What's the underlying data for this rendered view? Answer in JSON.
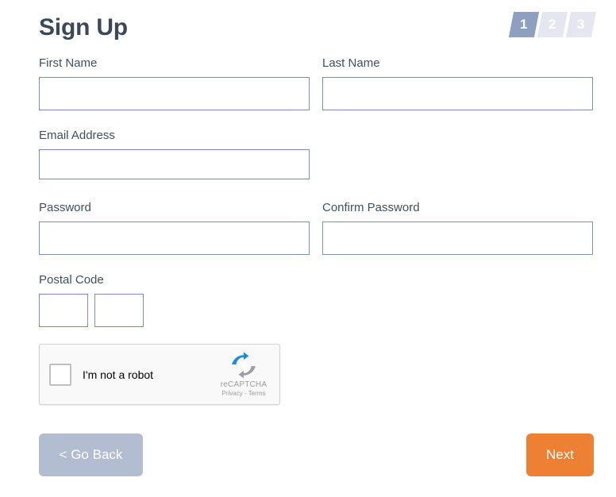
{
  "header": {
    "title": "Sign Up",
    "steps": [
      {
        "label": "1",
        "active": true
      },
      {
        "label": "2",
        "active": false
      },
      {
        "label": "3",
        "active": false
      }
    ]
  },
  "form": {
    "first_name": {
      "label": "First Name",
      "value": "",
      "placeholder": ""
    },
    "last_name": {
      "label": "Last Name",
      "value": "",
      "placeholder": ""
    },
    "email": {
      "label": "Email Address",
      "value": "",
      "placeholder": ""
    },
    "password": {
      "label": "Password",
      "value": "",
      "placeholder": ""
    },
    "confirm_password": {
      "label": "Confirm Password",
      "value": "",
      "placeholder": ""
    },
    "postal_code": {
      "label": "Postal Code",
      "part1_value": "",
      "part1_placeholder": "",
      "part2_value": "",
      "part2_placeholder": ""
    }
  },
  "recaptcha": {
    "label": "I'm not a robot",
    "checked": false,
    "brand": "reCAPTCHA",
    "links": "Privacy - Terms",
    "logo_icon": "recaptcha-logo-icon"
  },
  "footer": {
    "back_label": "< Go Back",
    "next_label": "Next"
  },
  "colors": {
    "accent_next": "#ee8034",
    "back_button": "#b3bdd2",
    "step_active": "#8f9fc0",
    "step_inactive": "#e4e7ef",
    "input_border": "#7d90b2",
    "title": "#3c4858"
  }
}
